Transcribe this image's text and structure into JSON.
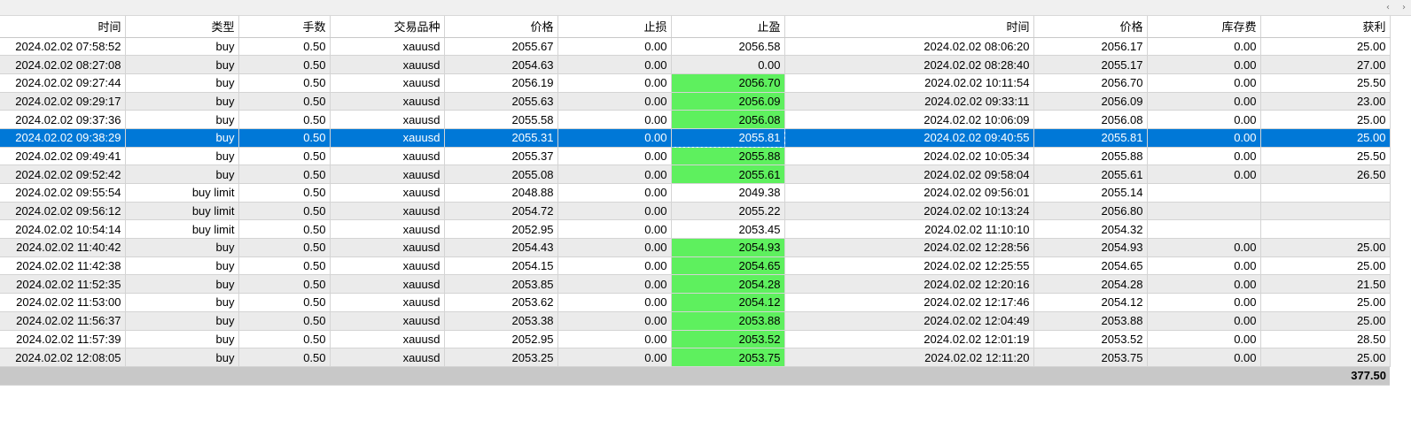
{
  "scroll": {
    "left": "‹",
    "right": "›"
  },
  "columns": [
    "时间",
    "类型",
    "手数",
    "交易品种",
    "价格",
    "止损",
    "止盈",
    "时间",
    "价格",
    "库存费",
    "获利"
  ],
  "rows": [
    {
      "open_time": "2024.02.02 07:58:52",
      "type": "buy",
      "lots": "0.50",
      "symbol": "xauusd",
      "open_price": "2055.67",
      "sl": "0.00",
      "tp": "2056.58",
      "close_time": "2024.02.02 08:06:20",
      "close_price": "2056.17",
      "swap": "0.00",
      "profit": "25.00",
      "tp_hit": false
    },
    {
      "open_time": "2024.02.02 08:27:08",
      "type": "buy",
      "lots": "0.50",
      "symbol": "xauusd",
      "open_price": "2054.63",
      "sl": "0.00",
      "tp": "0.00",
      "close_time": "2024.02.02 08:28:40",
      "close_price": "2055.17",
      "swap": "0.00",
      "profit": "27.00",
      "tp_hit": false
    },
    {
      "open_time": "2024.02.02 09:27:44",
      "type": "buy",
      "lots": "0.50",
      "symbol": "xauusd",
      "open_price": "2056.19",
      "sl": "0.00",
      "tp": "2056.70",
      "close_time": "2024.02.02 10:11:54",
      "close_price": "2056.70",
      "swap": "0.00",
      "profit": "25.50",
      "tp_hit": true
    },
    {
      "open_time": "2024.02.02 09:29:17",
      "type": "buy",
      "lots": "0.50",
      "symbol": "xauusd",
      "open_price": "2055.63",
      "sl": "0.00",
      "tp": "2056.09",
      "close_time": "2024.02.02 09:33:11",
      "close_price": "2056.09",
      "swap": "0.00",
      "profit": "23.00",
      "tp_hit": true
    },
    {
      "open_time": "2024.02.02 09:37:36",
      "type": "buy",
      "lots": "0.50",
      "symbol": "xauusd",
      "open_price": "2055.58",
      "sl": "0.00",
      "tp": "2056.08",
      "close_time": "2024.02.02 10:06:09",
      "close_price": "2056.08",
      "swap": "0.00",
      "profit": "25.00",
      "tp_hit": true
    },
    {
      "open_time": "2024.02.02 09:38:29",
      "type": "buy",
      "lots": "0.50",
      "symbol": "xauusd",
      "open_price": "2055.31",
      "sl": "0.00",
      "tp": "2055.81",
      "close_time": "2024.02.02 09:40:55",
      "close_price": "2055.81",
      "swap": "0.00",
      "profit": "25.00",
      "tp_hit": true,
      "selected": true
    },
    {
      "open_time": "2024.02.02 09:49:41",
      "type": "buy",
      "lots": "0.50",
      "symbol": "xauusd",
      "open_price": "2055.37",
      "sl": "0.00",
      "tp": "2055.88",
      "close_time": "2024.02.02 10:05:34",
      "close_price": "2055.88",
      "swap": "0.00",
      "profit": "25.50",
      "tp_hit": true
    },
    {
      "open_time": "2024.02.02 09:52:42",
      "type": "buy",
      "lots": "0.50",
      "symbol": "xauusd",
      "open_price": "2055.08",
      "sl": "0.00",
      "tp": "2055.61",
      "close_time": "2024.02.02 09:58:04",
      "close_price": "2055.61",
      "swap": "0.00",
      "profit": "26.50",
      "tp_hit": true
    },
    {
      "open_time": "2024.02.02 09:55:54",
      "type": "buy limit",
      "lots": "0.50",
      "symbol": "xauusd",
      "open_price": "2048.88",
      "sl": "0.00",
      "tp": "2049.38",
      "close_time": "2024.02.02 09:56:01",
      "close_price": "2055.14",
      "swap": "",
      "profit": "",
      "tp_hit": false
    },
    {
      "open_time": "2024.02.02 09:56:12",
      "type": "buy limit",
      "lots": "0.50",
      "symbol": "xauusd",
      "open_price": "2054.72",
      "sl": "0.00",
      "tp": "2055.22",
      "close_time": "2024.02.02 10:13:24",
      "close_price": "2056.80",
      "swap": "",
      "profit": "",
      "tp_hit": false
    },
    {
      "open_time": "2024.02.02 10:54:14",
      "type": "buy limit",
      "lots": "0.50",
      "symbol": "xauusd",
      "open_price": "2052.95",
      "sl": "0.00",
      "tp": "2053.45",
      "close_time": "2024.02.02 11:10:10",
      "close_price": "2054.32",
      "swap": "",
      "profit": "",
      "tp_hit": false
    },
    {
      "open_time": "2024.02.02 11:40:42",
      "type": "buy",
      "lots": "0.50",
      "symbol": "xauusd",
      "open_price": "2054.43",
      "sl": "0.00",
      "tp": "2054.93",
      "close_time": "2024.02.02 12:28:56",
      "close_price": "2054.93",
      "swap": "0.00",
      "profit": "25.00",
      "tp_hit": true
    },
    {
      "open_time": "2024.02.02 11:42:38",
      "type": "buy",
      "lots": "0.50",
      "symbol": "xauusd",
      "open_price": "2054.15",
      "sl": "0.00",
      "tp": "2054.65",
      "close_time": "2024.02.02 12:25:55",
      "close_price": "2054.65",
      "swap": "0.00",
      "profit": "25.00",
      "tp_hit": true
    },
    {
      "open_time": "2024.02.02 11:52:35",
      "type": "buy",
      "lots": "0.50",
      "symbol": "xauusd",
      "open_price": "2053.85",
      "sl": "0.00",
      "tp": "2054.28",
      "close_time": "2024.02.02 12:20:16",
      "close_price": "2054.28",
      "swap": "0.00",
      "profit": "21.50",
      "tp_hit": true
    },
    {
      "open_time": "2024.02.02 11:53:00",
      "type": "buy",
      "lots": "0.50",
      "symbol": "xauusd",
      "open_price": "2053.62",
      "sl": "0.00",
      "tp": "2054.12",
      "close_time": "2024.02.02 12:17:46",
      "close_price": "2054.12",
      "swap": "0.00",
      "profit": "25.00",
      "tp_hit": true
    },
    {
      "open_time": "2024.02.02 11:56:37",
      "type": "buy",
      "lots": "0.50",
      "symbol": "xauusd",
      "open_price": "2053.38",
      "sl": "0.00",
      "tp": "2053.88",
      "close_time": "2024.02.02 12:04:49",
      "close_price": "2053.88",
      "swap": "0.00",
      "profit": "25.00",
      "tp_hit": true
    },
    {
      "open_time": "2024.02.02 11:57:39",
      "type": "buy",
      "lots": "0.50",
      "symbol": "xauusd",
      "open_price": "2052.95",
      "sl": "0.00",
      "tp": "2053.52",
      "close_time": "2024.02.02 12:01:19",
      "close_price": "2053.52",
      "swap": "0.00",
      "profit": "28.50",
      "tp_hit": true
    },
    {
      "open_time": "2024.02.02 12:08:05",
      "type": "buy",
      "lots": "0.50",
      "symbol": "xauusd",
      "open_price": "2053.25",
      "sl": "0.00",
      "tp": "2053.75",
      "close_time": "2024.02.02 12:11:20",
      "close_price": "2053.75",
      "swap": "0.00",
      "profit": "25.00",
      "tp_hit": true
    }
  ],
  "total": {
    "profit": "377.50"
  },
  "colors": {
    "tp_hit": "#5ef05e",
    "selected_row": "#0078d7",
    "alt_row": "#ebebeb",
    "total_row": "#c8c8c8"
  }
}
